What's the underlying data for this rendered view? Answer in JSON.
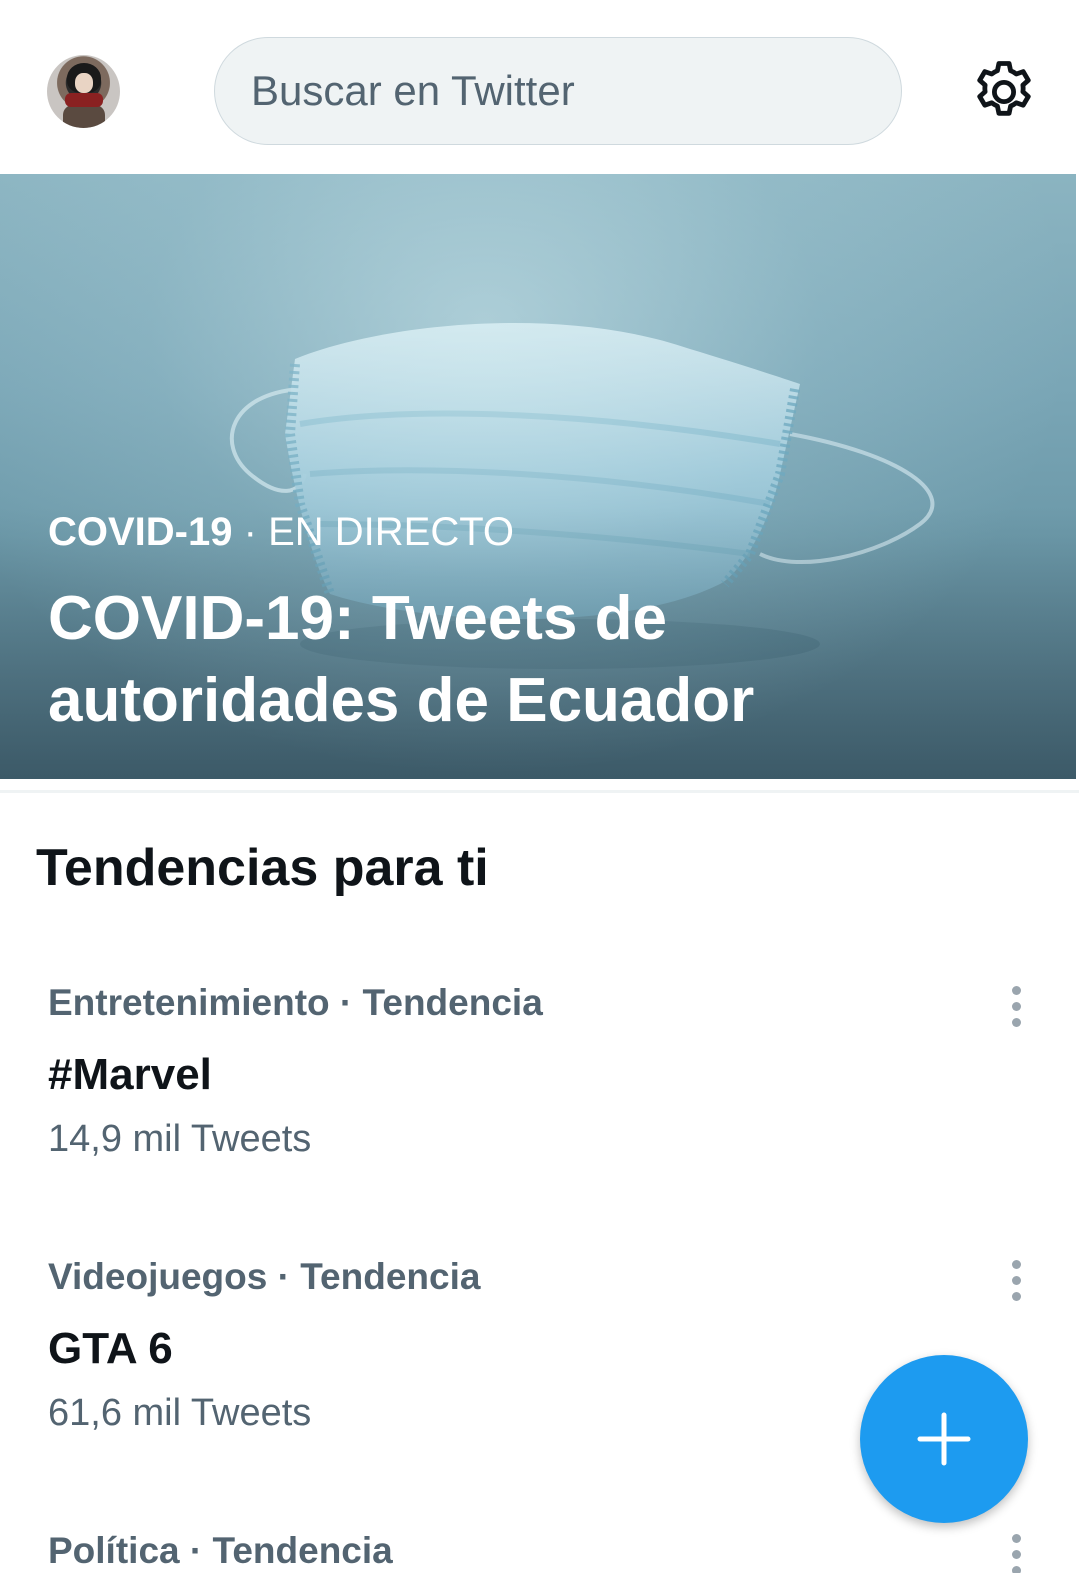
{
  "header": {
    "search_placeholder": "Buscar en Twitter"
  },
  "hero": {
    "category": "COVID-19",
    "separator": "·",
    "status": "EN DIRECTO",
    "title": "COVID-19: Tweets de autoridades de Ecuador"
  },
  "section_title": "Tendencias para ti",
  "trends": [
    {
      "category": "Entretenimiento · Tendencia",
      "name": "#Marvel",
      "count": "14,9 mil Tweets"
    },
    {
      "category": "Videojuegos · Tendencia",
      "name": "GTA 6",
      "count": "61,6 mil Tweets"
    },
    {
      "category": "Política · Tendencia"
    }
  ],
  "icons": {
    "settings": "gear-icon",
    "more": "more-vertical-icon",
    "compose": "plus-icon"
  },
  "colors": {
    "accent": "#1d9bf0",
    "secondary_text": "#536471",
    "primary_text": "#0f1419"
  }
}
